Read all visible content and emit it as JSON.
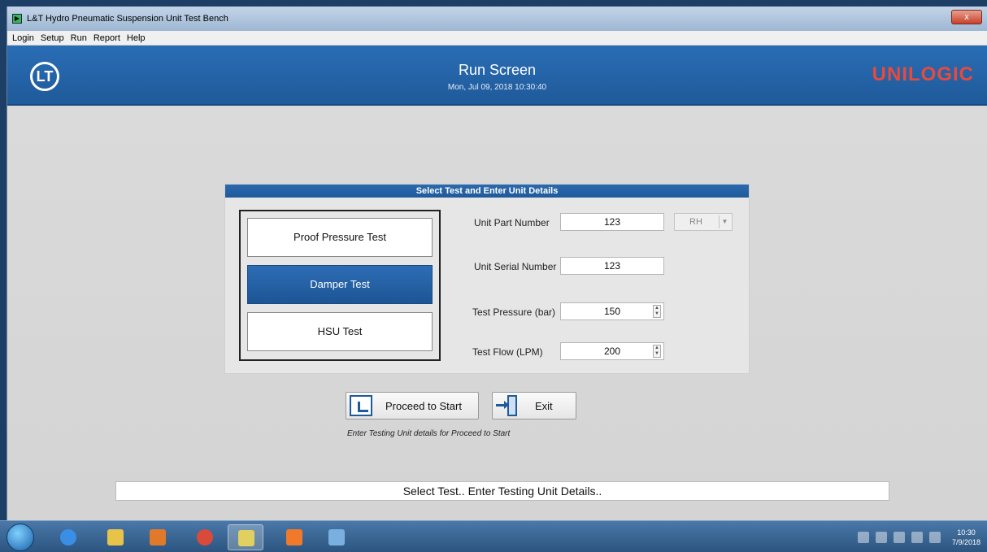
{
  "window": {
    "title": "L&T Hydro Pneumatic Suspension Unit Test Bench",
    "close_label": "x"
  },
  "menu": [
    "Login",
    "Setup",
    "Run",
    "Report",
    "Help"
  ],
  "header": {
    "title": "Run Screen",
    "date": "Mon, Jul 09, 2018 10:30:40",
    "brand": "UNILOGIC"
  },
  "panel": {
    "title": "Select Test and Enter Unit Details",
    "tests": [
      {
        "label": "Proof Pressure Test",
        "active": false
      },
      {
        "label": "Damper Test",
        "active": true
      },
      {
        "label": "HSU Test",
        "active": false
      }
    ],
    "fields": {
      "part_number_label": "Unit Part Number",
      "part_number_value": "123",
      "side_value": "RH",
      "serial_number_label": "Unit Serial Number",
      "serial_number_value": "123",
      "pressure_label": "Test Pressure (bar)",
      "pressure_value": "150",
      "flow_label": "Test Flow (LPM)",
      "flow_value": "200"
    }
  },
  "actions": {
    "proceed_label": "Proceed to Start",
    "exit_label": "Exit",
    "hint": "Enter Testing Unit details for Proceed to Start"
  },
  "status": "Select Test.. Enter Testing Unit Details..",
  "taskbar": {
    "time": "10:30",
    "date": "7/9/2018"
  }
}
